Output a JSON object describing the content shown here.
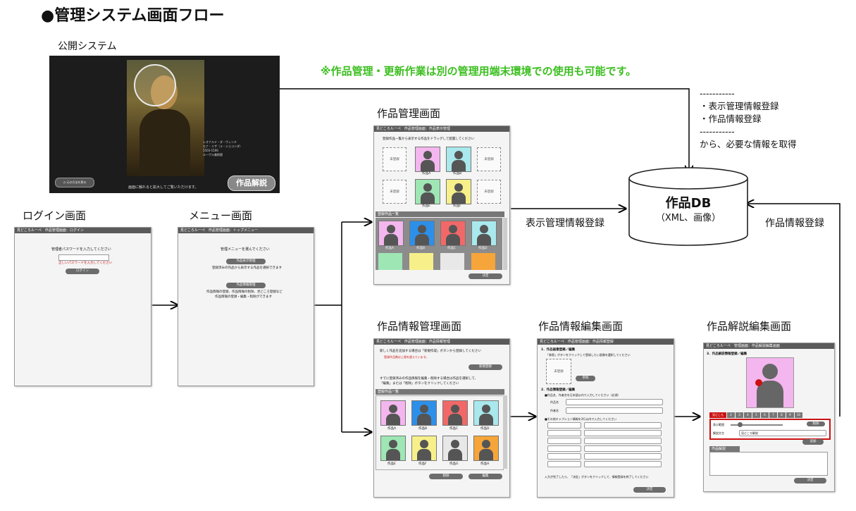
{
  "title": "●管理システム画面フロー",
  "note": "※作品管理・更新作業は別の管理用端末環境での使用も可能です。",
  "labels": {
    "public": "公開システム",
    "login": "ログイン画面",
    "menu": "メニュー画面",
    "work_mgmt": "作品管理画面",
    "work_info_mgmt": "作品情報管理画面",
    "work_info_edit": "作品情報編集画面",
    "work_commentary_edit": "作品解説編集画面"
  },
  "info": [
    "-----------",
    "・表示管理情報登録",
    "・作品情報登録",
    "-----------",
    "から、必要な情報を取得"
  ],
  "db": {
    "title": "作品DB",
    "sub": "（XML、画像）"
  },
  "edges": {
    "display_reg": "表示管理情報登録",
    "info_reg": "作品情報登録"
  },
  "public_screen": {
    "caption": "画面に触れると拡大してご覧いただけます。",
    "button": "作品解説",
    "back": "元の方法を探る",
    "artist": [
      "レオナルド・ダ・ヴィンチ",
      "モナ・リザ（ラ・ジョコンダ）",
      "1503-1506",
      "ルーヴル美術館"
    ]
  },
  "login_screen": {
    "bar": "見どころルーペ　作品管理画面：ログイン",
    "prompt": "管理者パスワードを入力してください",
    "error": "正しいパスワードを入力してください",
    "button": "ログイン"
  },
  "menu_screen": {
    "bar": "見どころルーペ　作品管理画面：トップメニュー",
    "prompt": "管理メニューを選んでください",
    "btn1": "作品表示管理",
    "desc1": "登録済みの作品から表示する作品を選択できます",
    "btn2": "作品情報管理",
    "desc2a": "作品情報の登録、作品情報の削除、見どころ登録など",
    "desc2b": "作品情報の登録・編集・削除ができます"
  },
  "wm_screen": {
    "bar": "見どころルーペ　作品管理画面：作品表示管理",
    "prompt": "登録作品一覧から表示する作品をドラッグして配置してください",
    "unreg": "未登録",
    "slots": [
      "作品A",
      "作品B",
      "作品E",
      "作品F"
    ],
    "list": "登録作品一覧",
    "items": [
      "作品A",
      "作品B",
      "作品C",
      "作品D"
    ],
    "ok": "決定"
  },
  "wi_screen": {
    "bar": "見どころルーペ　作品管理画面：作品情報管理",
    "p1": "新しく作品を追加する場合は「新規作成」ボタンから登録してください",
    "p1r": "登録作品数は上限を超えています。",
    "new": "新規登録",
    "p2a": "すでに登録済みの作品情報を編集・削除する場合は作品を選択して、",
    "p2b": "「編集」または「削除」ボタンをクリックしてください",
    "list": "登録作品一覧",
    "items": [
      "作品A",
      "作品B",
      "作品C",
      "作品D",
      "作品E",
      "作品F",
      "作品G",
      "作品H"
    ],
    "del": "削除",
    "edit": "編集"
  },
  "we_screen": {
    "bar": "見どころルーペ　作品管理画面：作品情報登録",
    "s1": "1．作品画像登録／編集",
    "s1d": "「参照」ボタンをクリックして登録したい画像を選択してください",
    "unreg": "未登録",
    "ref": "参照",
    "s2": "2．作品情報登録／編集",
    "s2a": "■作品名、作者名を日本語以内で入力してください（必須）",
    "f1": "作品名",
    "f2": "作者名",
    "s2b": "■その他キャプション情報を3行以内で入力してください",
    "foot": "入力が完了したら、「決定」ボタンをクリックして、情報登録を終了してください",
    "ok": "決定"
  },
  "wc_screen": {
    "bar": "見どころルーペ　管理画面：作品解説編集画面",
    "s3": "3．作品解説情報登録／編集",
    "tabs": [
      "見どころ",
      "2",
      "3",
      "4",
      "5",
      "6",
      "7",
      "8",
      "9",
      "10"
    ],
    "r1": "表示範囲",
    "r2": "解説文言",
    "v2": "見どころ解説",
    "del": "削除",
    "add": "追加",
    "panel": "作品解説",
    "ok": "決定"
  },
  "colors": {
    "note": "#3bbf1f",
    "bar": "#5a5a5a",
    "red": "#cc1111"
  }
}
